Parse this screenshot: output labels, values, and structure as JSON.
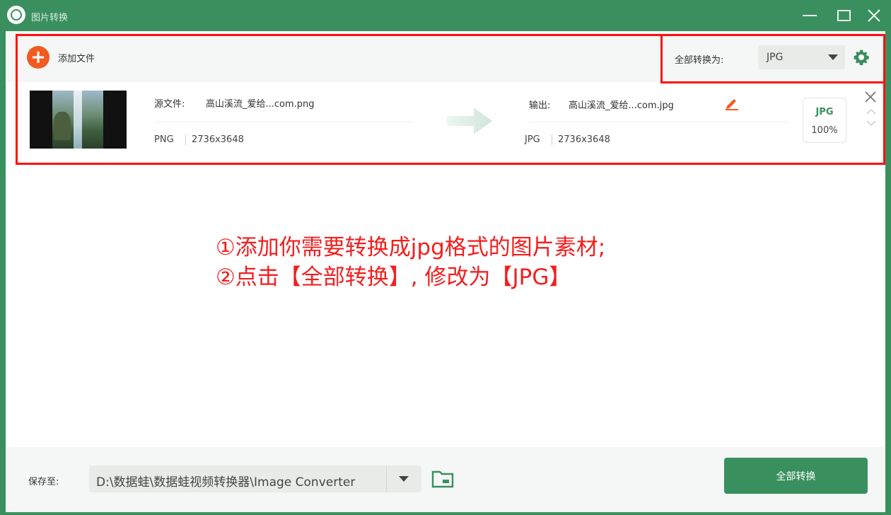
{
  "window": {
    "title": "图片转换",
    "icons": {
      "logo": "app-logo-icon",
      "minimize": "minimize-icon",
      "maximize": "maximize-icon",
      "close": "close-icon"
    }
  },
  "toolbar": {
    "add_label": "添加文件",
    "add_icon": "plus-icon",
    "convert_all_label": "全部转换为:",
    "format_value": "JPG",
    "settings_icon": "gear-icon"
  },
  "file": {
    "source_label": "源文件:",
    "source_name": "高山溪流_爱给...com.png",
    "source_format": "PNG",
    "source_dimensions": "2736x3648",
    "output_label": "输出:",
    "output_name": "高山溪流_爱给...com.jpg",
    "output_format": "JPG",
    "output_dimensions": "2736x3648",
    "badge_format": "JPG",
    "badge_quality": "100%",
    "icons": {
      "thumbnail": "waterfall-thumbnail",
      "arrow": "arrow-right-icon",
      "edit": "pencil-icon",
      "remove": "close-icon",
      "up": "chevron-up-icon",
      "down": "chevron-down-icon"
    }
  },
  "annotation": {
    "line1": "①添加你需要转换成jpg格式的图片素材;",
    "line2": "②点击【全部转换】, 修改为【JPG】",
    "color": "#f41e1e"
  },
  "footer": {
    "save_label": "保存至:",
    "path": "D:\\数据蛙\\数据蛙视频转换器\\Image Converter",
    "folder_icon": "folder-icon",
    "convert_button": "全部转换"
  },
  "colors": {
    "accent": "#3a8f5e",
    "add": "#f35a1f",
    "annotation": "#ff1010"
  }
}
